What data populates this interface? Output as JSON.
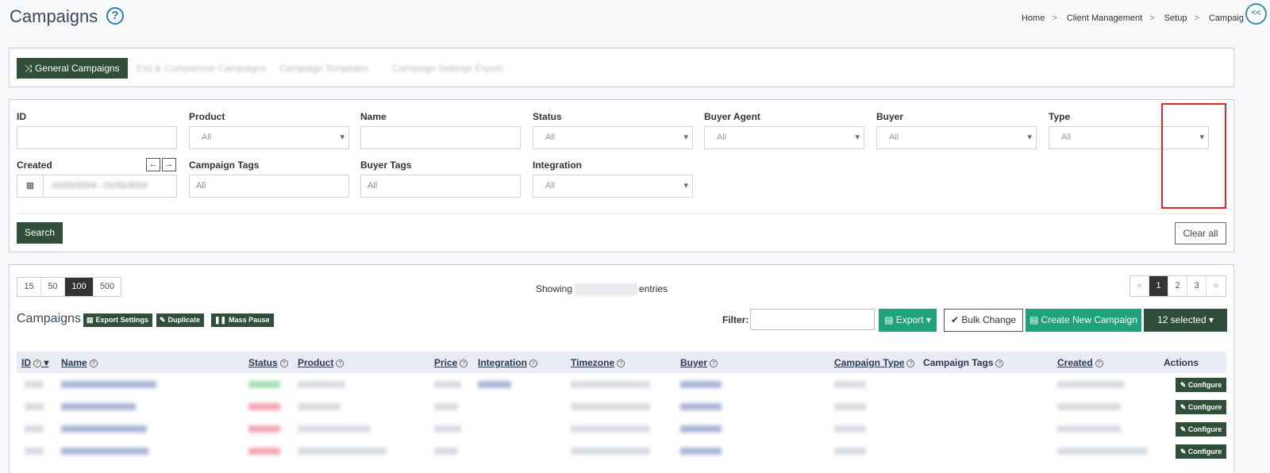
{
  "header": {
    "title": "Campaigns",
    "breadcrumb": [
      "Home",
      "Client Management",
      "Setup",
      "Campaig"
    ],
    "collapse_label": "<<"
  },
  "tabs": [
    {
      "label": "General Campaigns",
      "active": true
    },
    {
      "label": "Exit & Comparison Campaigns",
      "active": false
    },
    {
      "label": "Campaign Templates",
      "active": false
    },
    {
      "label": "Campaign Settings Export",
      "active": false
    }
  ],
  "filters": {
    "id": {
      "label": "ID",
      "value": ""
    },
    "product": {
      "label": "Product",
      "value": "All"
    },
    "name": {
      "label": "Name",
      "value": ""
    },
    "status": {
      "label": "Status",
      "value": "All"
    },
    "buyer_agent": {
      "label": "Buyer Agent",
      "value": "All"
    },
    "buyer": {
      "label": "Buyer",
      "value": "All"
    },
    "type": {
      "label": "Type",
      "value": "All"
    },
    "created": {
      "label": "Created",
      "value": "01/01/2024 - 01/31/2024"
    },
    "campaign_tags": {
      "label": "Campaign Tags",
      "placeholder": "All"
    },
    "buyer_tags": {
      "label": "Buyer Tags",
      "placeholder": "All"
    },
    "integration": {
      "label": "Integration",
      "value": "All"
    },
    "search_label": "Search",
    "clear_label": "Clear all"
  },
  "table_controls": {
    "page_sizes": [
      "15",
      "50",
      "100",
      "500"
    ],
    "active_page_size": "100",
    "showing_prefix": "Showing",
    "showing_suffix": "entries",
    "pages": [
      "«",
      "1",
      "2",
      "3",
      "»"
    ],
    "active_page": "1",
    "title": "Campaigns",
    "export_settings_label": "Export Settings",
    "duplicate_label": "Duplicate",
    "mass_pause_label": "Mass Pause",
    "filter_label": "Filter:",
    "export_label": "Export ▾",
    "bulk_change_label": "Bulk Change",
    "create_label": "Create New Campaign",
    "selected_label": "12 selected ▾"
  },
  "columns": [
    "ID",
    "Name",
    "Status",
    "Product",
    "Price",
    "Integration",
    "Timezone",
    "Buyer",
    "Campaign Type",
    "Campaign Tags",
    "Created",
    "Actions"
  ],
  "rows": [
    {
      "configure_label": "Configure"
    },
    {
      "configure_label": "Configure"
    },
    {
      "configure_label": "Configure"
    },
    {
      "configure_label": "Configure"
    }
  ],
  "colors": {
    "primary_dark": "#2f4f39",
    "teal": "#1fa37a",
    "highlight": "#e0262b"
  }
}
